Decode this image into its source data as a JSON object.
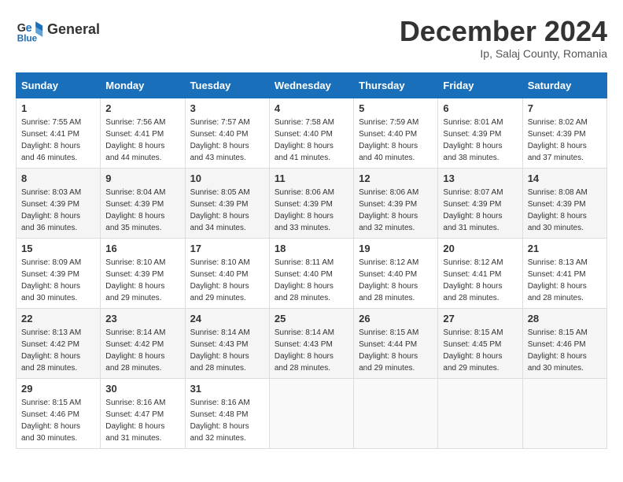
{
  "logo": {
    "general": "General",
    "blue": "Blue"
  },
  "title": "December 2024",
  "subtitle": "Ip, Salaj County, Romania",
  "days_of_week": [
    "Sunday",
    "Monday",
    "Tuesday",
    "Wednesday",
    "Thursday",
    "Friday",
    "Saturday"
  ],
  "weeks": [
    [
      {
        "day": "1",
        "sunrise": "7:55 AM",
        "sunset": "4:41 PM",
        "daylight": "8 hours and 46 minutes."
      },
      {
        "day": "2",
        "sunrise": "7:56 AM",
        "sunset": "4:41 PM",
        "daylight": "8 hours and 44 minutes."
      },
      {
        "day": "3",
        "sunrise": "7:57 AM",
        "sunset": "4:40 PM",
        "daylight": "8 hours and 43 minutes."
      },
      {
        "day": "4",
        "sunrise": "7:58 AM",
        "sunset": "4:40 PM",
        "daylight": "8 hours and 41 minutes."
      },
      {
        "day": "5",
        "sunrise": "7:59 AM",
        "sunset": "4:40 PM",
        "daylight": "8 hours and 40 minutes."
      },
      {
        "day": "6",
        "sunrise": "8:01 AM",
        "sunset": "4:39 PM",
        "daylight": "8 hours and 38 minutes."
      },
      {
        "day": "7",
        "sunrise": "8:02 AM",
        "sunset": "4:39 PM",
        "daylight": "8 hours and 37 minutes."
      }
    ],
    [
      {
        "day": "8",
        "sunrise": "8:03 AM",
        "sunset": "4:39 PM",
        "daylight": "8 hours and 36 minutes."
      },
      {
        "day": "9",
        "sunrise": "8:04 AM",
        "sunset": "4:39 PM",
        "daylight": "8 hours and 35 minutes."
      },
      {
        "day": "10",
        "sunrise": "8:05 AM",
        "sunset": "4:39 PM",
        "daylight": "8 hours and 34 minutes."
      },
      {
        "day": "11",
        "sunrise": "8:06 AM",
        "sunset": "4:39 PM",
        "daylight": "8 hours and 33 minutes."
      },
      {
        "day": "12",
        "sunrise": "8:06 AM",
        "sunset": "4:39 PM",
        "daylight": "8 hours and 32 minutes."
      },
      {
        "day": "13",
        "sunrise": "8:07 AM",
        "sunset": "4:39 PM",
        "daylight": "8 hours and 31 minutes."
      },
      {
        "day": "14",
        "sunrise": "8:08 AM",
        "sunset": "4:39 PM",
        "daylight": "8 hours and 30 minutes."
      }
    ],
    [
      {
        "day": "15",
        "sunrise": "8:09 AM",
        "sunset": "4:39 PM",
        "daylight": "8 hours and 30 minutes."
      },
      {
        "day": "16",
        "sunrise": "8:10 AM",
        "sunset": "4:39 PM",
        "daylight": "8 hours and 29 minutes."
      },
      {
        "day": "17",
        "sunrise": "8:10 AM",
        "sunset": "4:40 PM",
        "daylight": "8 hours and 29 minutes."
      },
      {
        "day": "18",
        "sunrise": "8:11 AM",
        "sunset": "4:40 PM",
        "daylight": "8 hours and 28 minutes."
      },
      {
        "day": "19",
        "sunrise": "8:12 AM",
        "sunset": "4:40 PM",
        "daylight": "8 hours and 28 minutes."
      },
      {
        "day": "20",
        "sunrise": "8:12 AM",
        "sunset": "4:41 PM",
        "daylight": "8 hours and 28 minutes."
      },
      {
        "day": "21",
        "sunrise": "8:13 AM",
        "sunset": "4:41 PM",
        "daylight": "8 hours and 28 minutes."
      }
    ],
    [
      {
        "day": "22",
        "sunrise": "8:13 AM",
        "sunset": "4:42 PM",
        "daylight": "8 hours and 28 minutes."
      },
      {
        "day": "23",
        "sunrise": "8:14 AM",
        "sunset": "4:42 PM",
        "daylight": "8 hours and 28 minutes."
      },
      {
        "day": "24",
        "sunrise": "8:14 AM",
        "sunset": "4:43 PM",
        "daylight": "8 hours and 28 minutes."
      },
      {
        "day": "25",
        "sunrise": "8:14 AM",
        "sunset": "4:43 PM",
        "daylight": "8 hours and 28 minutes."
      },
      {
        "day": "26",
        "sunrise": "8:15 AM",
        "sunset": "4:44 PM",
        "daylight": "8 hours and 29 minutes."
      },
      {
        "day": "27",
        "sunrise": "8:15 AM",
        "sunset": "4:45 PM",
        "daylight": "8 hours and 29 minutes."
      },
      {
        "day": "28",
        "sunrise": "8:15 AM",
        "sunset": "4:46 PM",
        "daylight": "8 hours and 30 minutes."
      }
    ],
    [
      {
        "day": "29",
        "sunrise": "8:15 AM",
        "sunset": "4:46 PM",
        "daylight": "8 hours and 30 minutes."
      },
      {
        "day": "30",
        "sunrise": "8:16 AM",
        "sunset": "4:47 PM",
        "daylight": "8 hours and 31 minutes."
      },
      {
        "day": "31",
        "sunrise": "8:16 AM",
        "sunset": "4:48 PM",
        "daylight": "8 hours and 32 minutes."
      },
      null,
      null,
      null,
      null
    ]
  ]
}
